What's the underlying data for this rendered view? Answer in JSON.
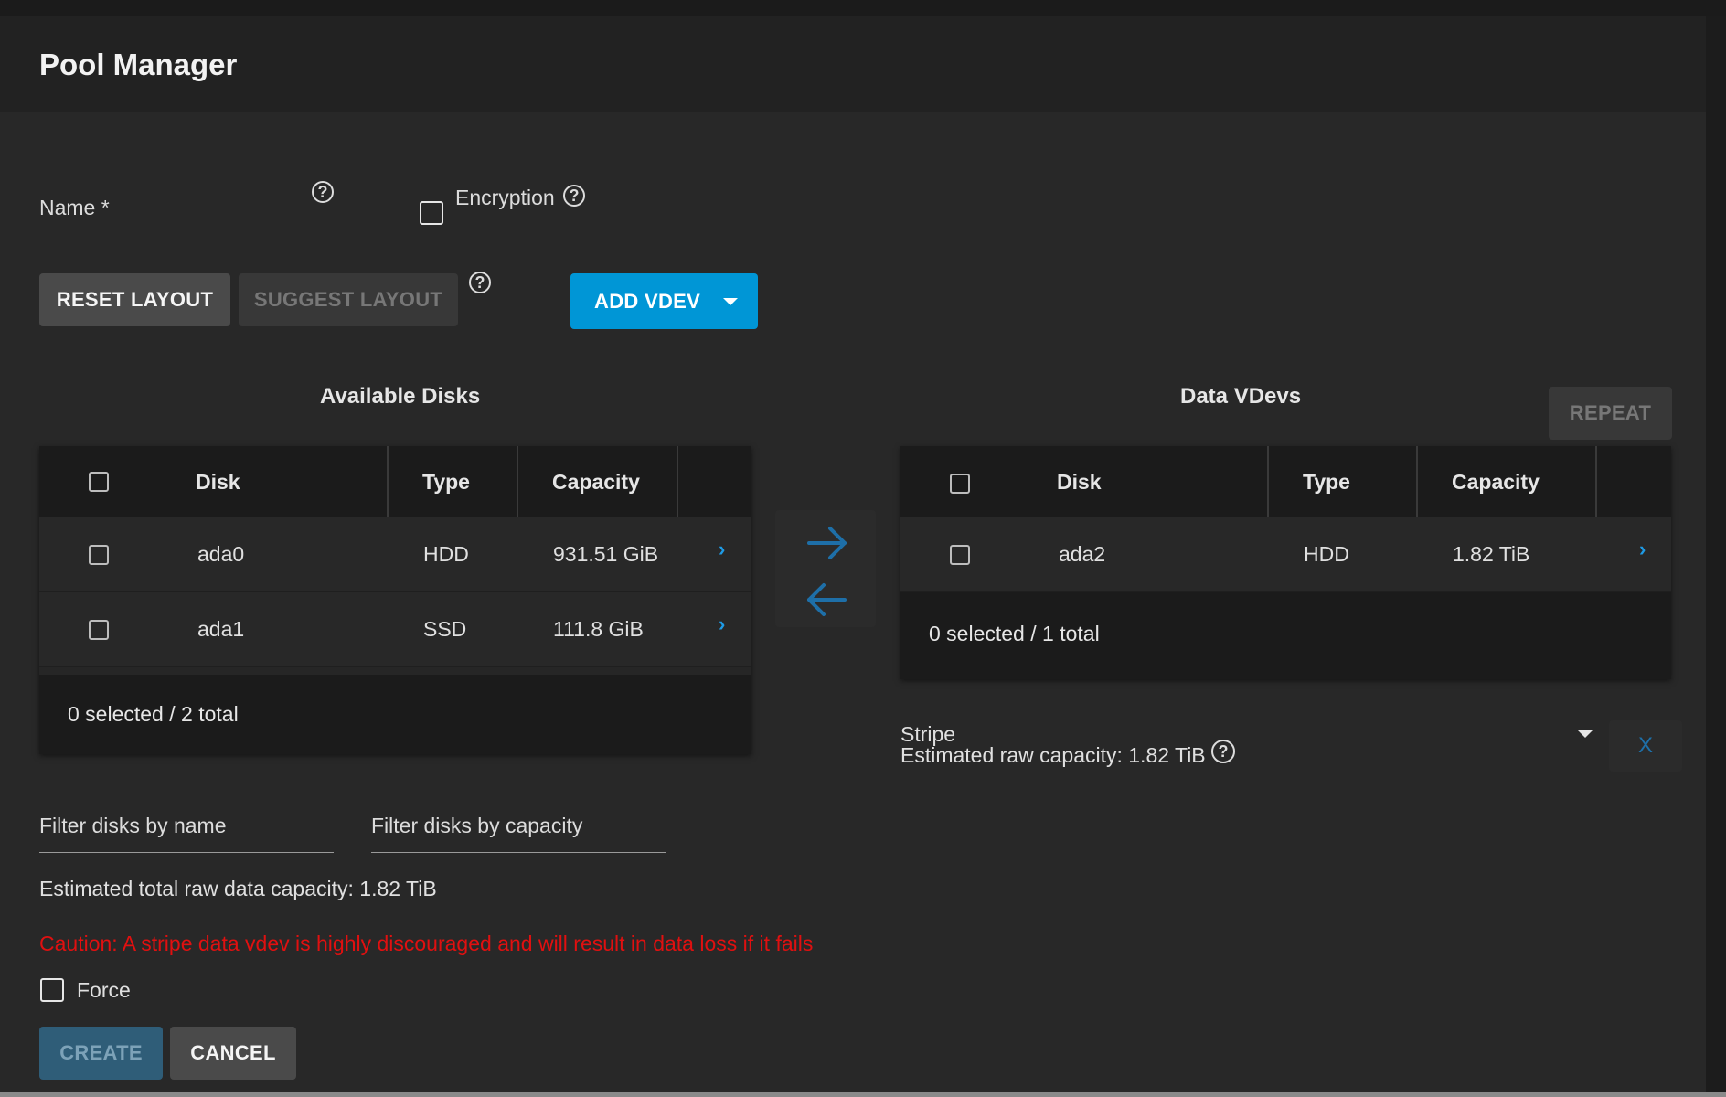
{
  "dialog": {
    "title": "Pool Manager"
  },
  "form": {
    "name_label": "Name *",
    "encryption_label": "Encryption"
  },
  "buttons": {
    "reset_layout": "RESET LAYOUT",
    "suggest_layout": "SUGGEST LAYOUT",
    "add_vdev": "ADD VDEV",
    "repeat": "REPEAT",
    "create": "CREATE",
    "cancel": "CANCEL",
    "remove": "X"
  },
  "available_disks": {
    "title": "Available Disks",
    "columns": [
      "Disk",
      "Type",
      "Capacity"
    ],
    "rows": [
      {
        "disk": "ada0",
        "type": "HDD",
        "capacity": "931.51 GiB"
      },
      {
        "disk": "ada1",
        "type": "SSD",
        "capacity": "111.8 GiB"
      }
    ],
    "footer": "0 selected / 2 total"
  },
  "data_vdevs": {
    "title": "Data VDevs",
    "columns": [
      "Disk",
      "Type",
      "Capacity"
    ],
    "rows": [
      {
        "disk": "ada2",
        "type": "HDD",
        "capacity": "1.82 TiB"
      }
    ],
    "footer": "0 selected / 1 total",
    "layout_value": "Stripe",
    "estimated_raw": "Estimated raw capacity: 1.82 TiB"
  },
  "filters": {
    "by_name_placeholder": "Filter disks by name",
    "by_capacity_placeholder": "Filter disks by capacity"
  },
  "summary": {
    "estimated_total": "Estimated total raw data capacity: 1.82 TiB",
    "caution": "Caution: A stripe data vdev is highly discouraged and will result in data loss if it fails",
    "force_label": "Force"
  },
  "colors": {
    "accent": "#0096d6",
    "caution": "#e01010",
    "background": "#282828"
  },
  "icons": {
    "help": "question-circle",
    "row_open": "chevron-right",
    "move_right": "arrow-right",
    "move_left": "arrow-left",
    "dropdown": "caret-down"
  }
}
